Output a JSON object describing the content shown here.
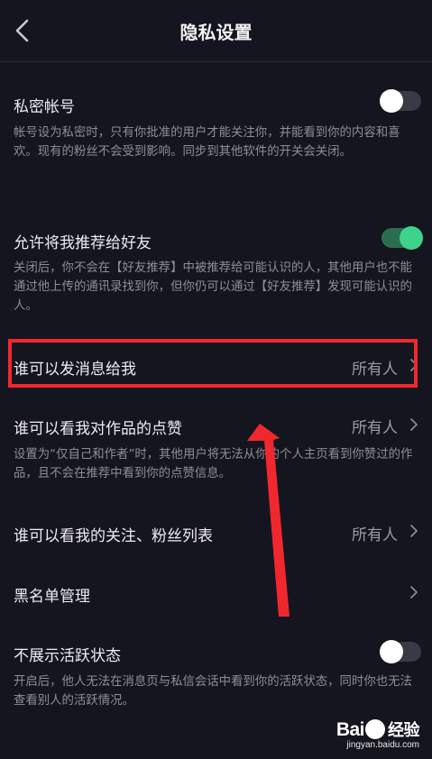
{
  "header": {
    "title": "隐私设置"
  },
  "settings": {
    "private_account": {
      "title": "私密帐号",
      "desc": "帐号设为私密时，只有你批准的用户才能关注你，并能看到你的内容和喜欢。现有的粉丝不会受到影响。同步到其他软件的开关会关闭。",
      "enabled": false
    },
    "recommend_to_friends": {
      "title": "允许将我推荐给好友",
      "desc": "关闭后，你不会在【好友推荐】中被推荐给可能认识的人，其他用户也不能通过他上传的通讯录找到你，但你仍可以通过【好友推荐】发现可能认识的人。",
      "enabled": true
    },
    "who_can_message": {
      "title": "谁可以发消息给我",
      "value": "所有人"
    },
    "who_can_see_likes": {
      "title": "谁可以看我对作品的点赞",
      "value": "所有人",
      "desc": "设置为“仅自己和作者”时，其他用户将无法从你的个人主页看到你赞过的作品，且不会在推荐中看到你的点赞信息。"
    },
    "who_can_see_follow_list": {
      "title": "谁可以看我的关注、粉丝列表",
      "value": "所有人"
    },
    "blacklist": {
      "title": "黑名单管理"
    },
    "hide_active_status": {
      "title": "不展示活跃状态",
      "desc": "开启后，他人无法在消息页与私信会话中看到你的活跃状态，同时你也无法查看别人的活跃情况。",
      "enabled": false
    }
  },
  "watermark": {
    "logo_a": "Bai",
    "logo_b": "经验",
    "url": "jingyan.baidu.com"
  },
  "colors": {
    "background": "#15151f",
    "toggle_on": "#3ed38c",
    "highlight": "#f0282e"
  }
}
